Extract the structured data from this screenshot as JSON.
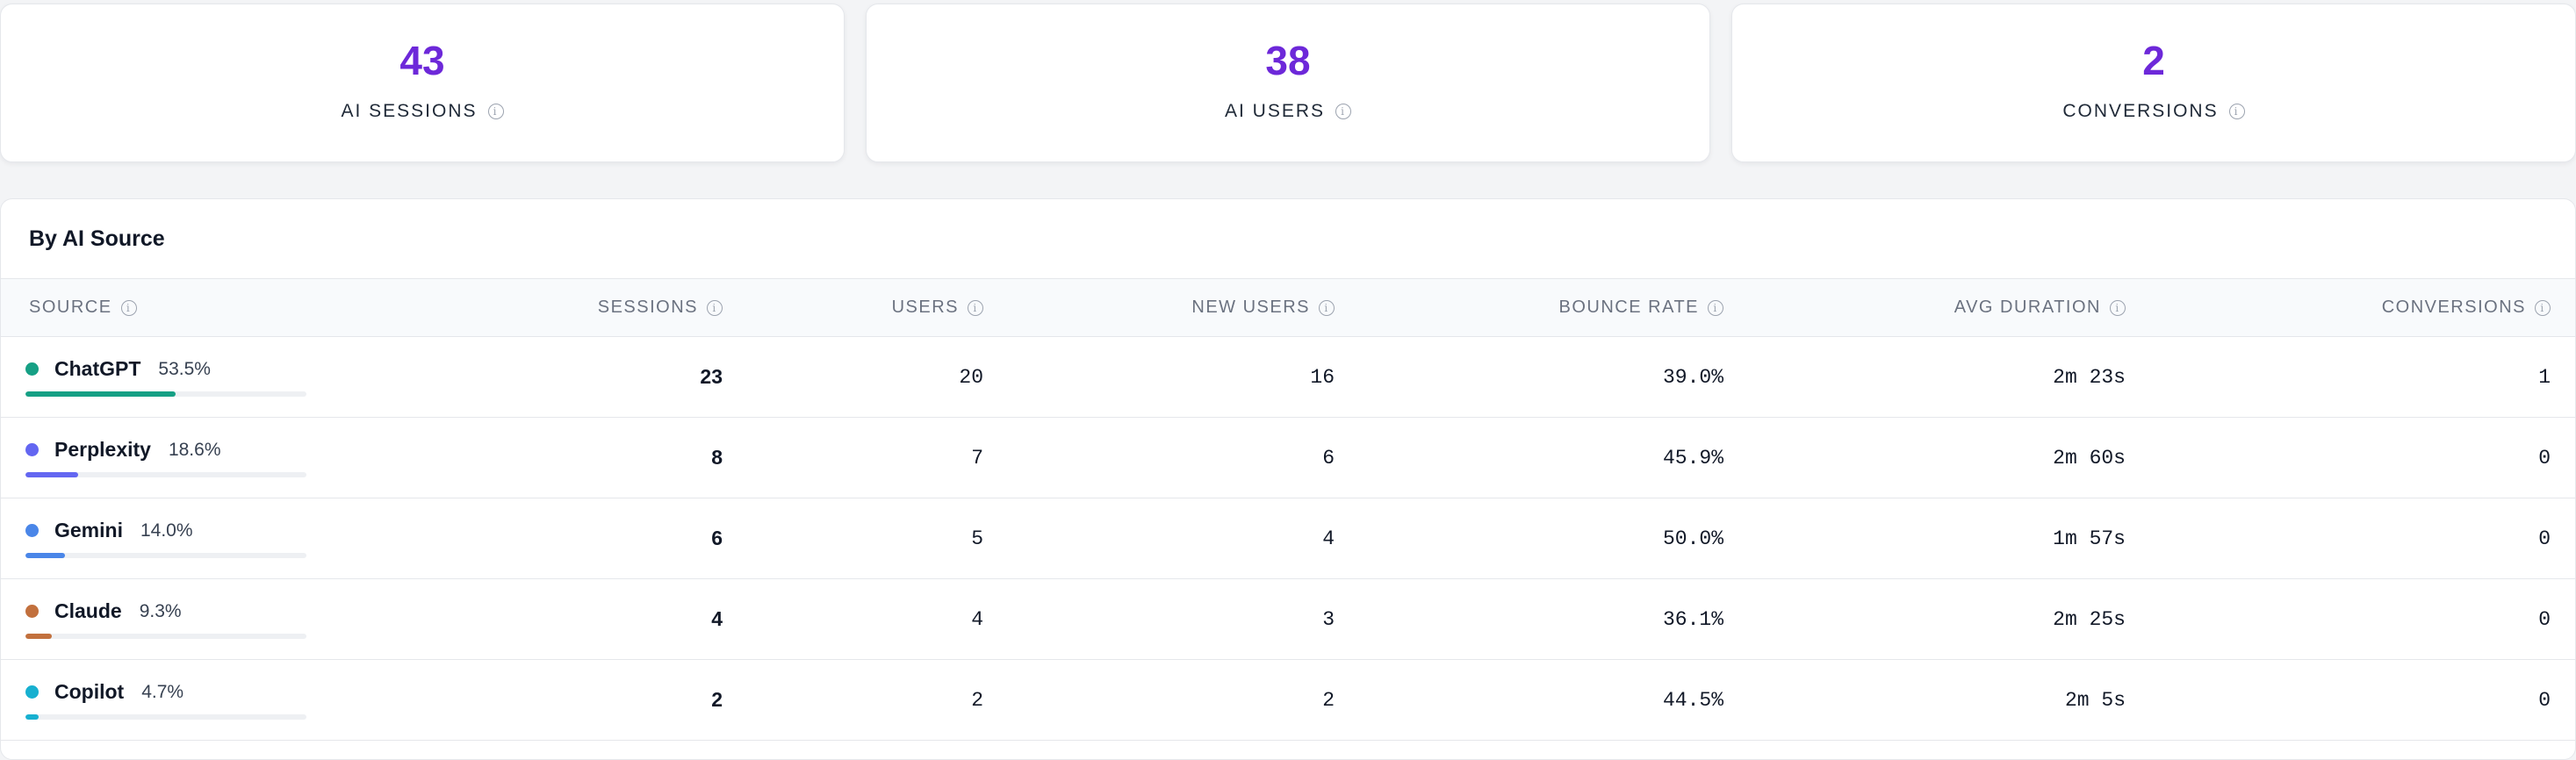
{
  "summary": [
    {
      "value": "43",
      "label": "AI SESSIONS"
    },
    {
      "value": "38",
      "label": "AI USERS"
    },
    {
      "value": "2",
      "label": "CONVERSIONS"
    }
  ],
  "panel": {
    "title": "By AI Source",
    "columns": [
      "SOURCE",
      "SESSIONS",
      "USERS",
      "NEW USERS",
      "BOUNCE RATE",
      "AVG DURATION",
      "CONVERSIONS"
    ]
  },
  "rows": [
    {
      "source": "ChatGPT",
      "share": "53.5%",
      "share_value": 53.5,
      "color": "#16a085",
      "sessions": "23",
      "users": "20",
      "new_users": "16",
      "bounce_rate": "39.0%",
      "avg_duration": "2m 23s",
      "conversions": "1"
    },
    {
      "source": "Perplexity",
      "share": "18.6%",
      "share_value": 18.6,
      "color": "#6366f1",
      "sessions": "8",
      "users": "7",
      "new_users": "6",
      "bounce_rate": "45.9%",
      "avg_duration": "2m 60s",
      "conversions": "0"
    },
    {
      "source": "Gemini",
      "share": "14.0%",
      "share_value": 14.0,
      "color": "#4a86e8",
      "sessions": "6",
      "users": "5",
      "new_users": "4",
      "bounce_rate": "50.0%",
      "avg_duration": "1m 57s",
      "conversions": "0"
    },
    {
      "source": "Claude",
      "share": "9.3%",
      "share_value": 9.3,
      "color": "#c2703d",
      "sessions": "4",
      "users": "4",
      "new_users": "3",
      "bounce_rate": "36.1%",
      "avg_duration": "2m 25s",
      "conversions": "0"
    },
    {
      "source": "Copilot",
      "share": "4.7%",
      "share_value": 4.7,
      "color": "#17b0d0",
      "sessions": "2",
      "users": "2",
      "new_users": "2",
      "bounce_rate": "44.5%",
      "avg_duration": "2m 5s",
      "conversions": "0"
    }
  ]
}
